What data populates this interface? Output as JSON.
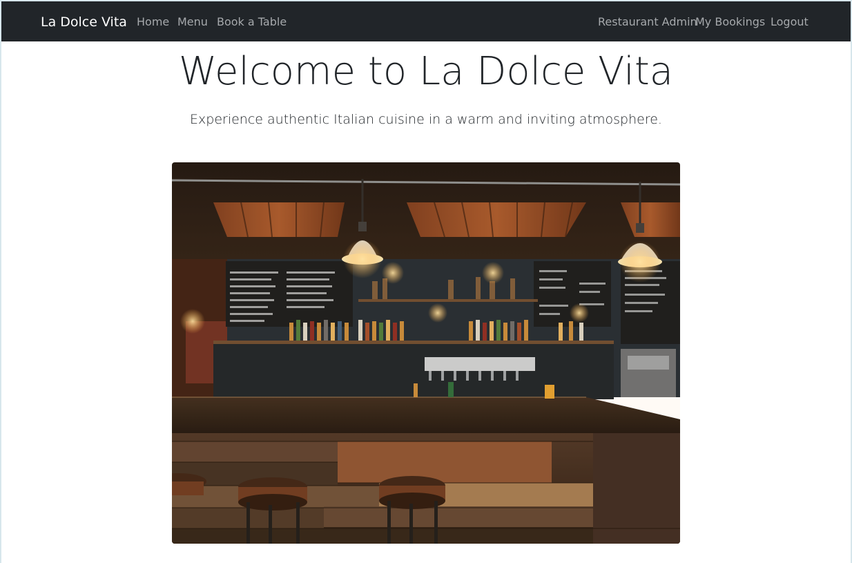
{
  "navbar": {
    "brand": "La Dolce Vita",
    "left_links": [
      "Home",
      "Menu",
      "Book a Table"
    ],
    "right_links": [
      "Restaurant Admin",
      "My Bookings",
      "Logout"
    ]
  },
  "hero": {
    "title": "Welcome to La Dolce Vita",
    "lead": "Experience authentic Italian cuisine in a warm and inviting atmosphere."
  },
  "image": {
    "subject": "restaurant bar interior"
  },
  "colors": {
    "navbar_bg": "#212529",
    "brand_text": "#ffffff",
    "nav_link": "#a6a9ac",
    "body_text": "#212529",
    "page_bg": "#ffffff"
  }
}
